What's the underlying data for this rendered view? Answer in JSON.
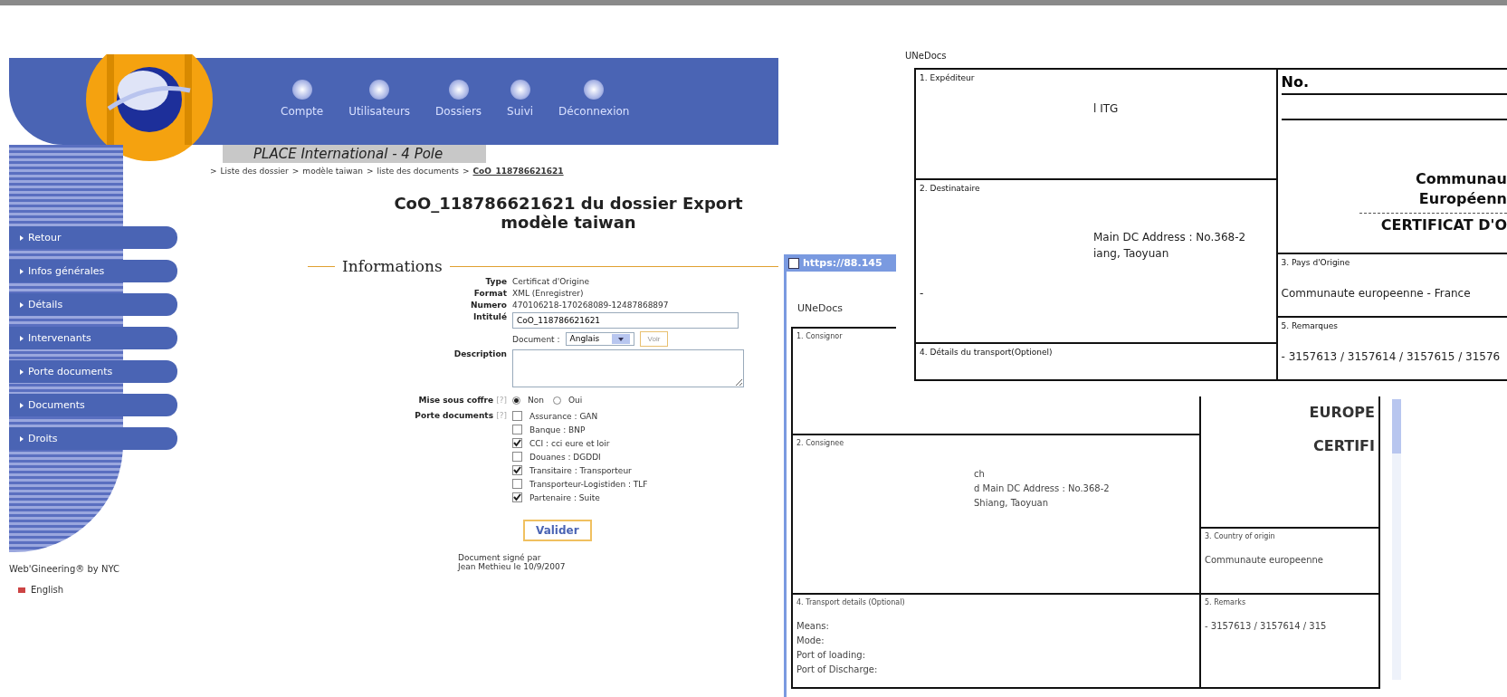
{
  "top_nav": {
    "items": [
      "Compte",
      "Utilisateurs",
      "Dossiers",
      "Suivi",
      "Déconnexion"
    ]
  },
  "site_title": "PLACE International - 4 Pole",
  "breadcrumb": {
    "separator": ">",
    "items": [
      "Liste des dossier",
      "modèle taiwan",
      "liste des documents"
    ],
    "current": "CoO_118786621621"
  },
  "sidebar": {
    "items": [
      "Retour",
      "Infos générales",
      "Détails",
      "Intervenants",
      "Porte documents",
      "Documents",
      "Droits"
    ],
    "credit": "Web'Gineering® by NYC",
    "language": "English"
  },
  "page_title": [
    "CoO_118786621621 du dossier Export",
    "modèle taiwan"
  ],
  "section": "Informations",
  "fields": [
    {
      "label": "Type",
      "value": "Certificat d'Origine"
    },
    {
      "label": "Format",
      "value": "XML (Enregistrer)"
    },
    {
      "label": "Numero",
      "value": "470106218-170268089-12487868897"
    }
  ],
  "intitule": {
    "label": "Intitulé",
    "value": "CoO_118786621621"
  },
  "document_select": {
    "label": "Document :",
    "value": "Anglais",
    "button": "Voir"
  },
  "description": {
    "label": "Description"
  },
  "mise_sous_coffre": {
    "label": "Mise sous coffre",
    "help": "[?]",
    "options": [
      {
        "label": "Non",
        "selected": true
      },
      {
        "label": "Oui",
        "selected": false
      }
    ]
  },
  "porte_documents": {
    "label": "Porte documents",
    "help": "[?]",
    "options": [
      {
        "label": "Assurance : GAN",
        "checked": false
      },
      {
        "label": "Banque : BNP",
        "checked": false
      },
      {
        "label": "CCI : cci eure et loir",
        "checked": true
      },
      {
        "label": "Douanes : DGDDI",
        "checked": false
      },
      {
        "label": "Transitaire : Transporteur",
        "checked": true
      },
      {
        "label": "Transporteur-Logistiden : TLF",
        "checked": false
      },
      {
        "label": "Partenaire : Suite",
        "checked": true
      }
    ]
  },
  "submit": "Valider",
  "signature": [
    "Document signé par",
    "Jean Methieu le 10/9/2007"
  ],
  "popup": {
    "title": "https://88.145",
    "brand": "UNeDocs",
    "consignor": {
      "label": "1. Consignor"
    },
    "consignee": {
      "label": "2. Consignee",
      "lines": [
        "ch",
        "d Main DC Address : No.368-2",
        "Shiang, Taoyuan"
      ]
    },
    "heading": "EUROPE",
    "subheading": "CERTIFI",
    "origin": {
      "label": "3. Country of origin",
      "value": "Communaute europeenne"
    },
    "transport": {
      "label": "4. Transport details (Optional)",
      "lines": [
        "Means:",
        "Mode:",
        "Port of loading:",
        "Port of Discharge:"
      ]
    },
    "remarks": {
      "label": "5. Remarks",
      "value": "- 3157613 / 3157614 / 315"
    }
  },
  "french_document": {
    "brand": "UNeDocs",
    "shipper": {
      "label": "1. Expéditeur",
      "lines": [
        "l ITG"
      ]
    },
    "consignee": {
      "label": "2. Destinataire",
      "lines": [
        "Main DC Address : No.368-2",
        "iang, Taoyuan"
      ],
      "note": "-"
    },
    "number_label": "No.",
    "heading": [
      "Communau",
      "Européenn"
    ],
    "subheading": "CERTIFICAT D'O",
    "origin": {
      "label": "3. Pays d'Origine",
      "value": "Communaute europeenne - France"
    },
    "transport": {
      "label": "4. Détails du transport(Optionel)"
    },
    "remarks": {
      "label": "5. Remarques",
      "value": "- 3157613 / 3157614 / 3157615 / 31576"
    }
  }
}
